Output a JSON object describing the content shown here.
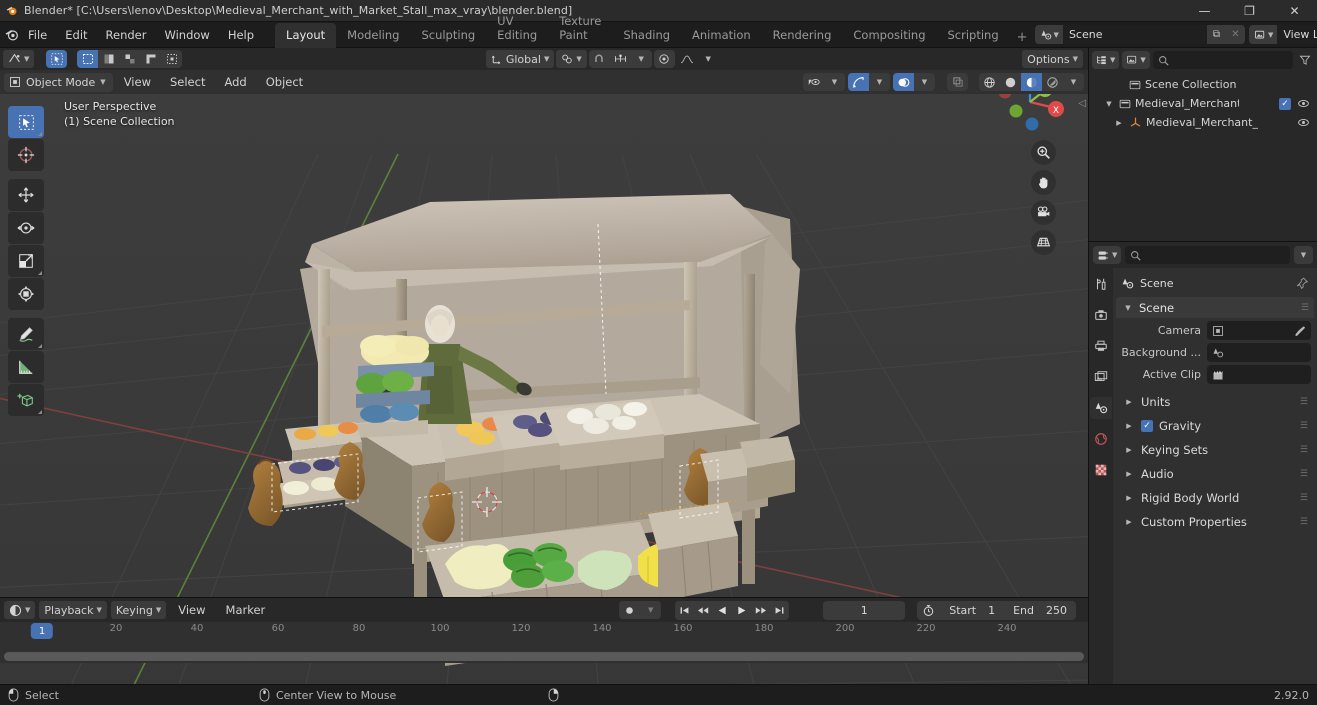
{
  "window": {
    "title": "Blender* [C:\\Users\\lenov\\Desktop\\Medieval_Merchant_with_Market_Stall_max_vray\\blender.blend]",
    "minimize": "—",
    "maximize": "❐",
    "close": "✕"
  },
  "menubar": {
    "items": [
      "File",
      "Edit",
      "Render",
      "Window",
      "Help"
    ],
    "workspaces": [
      {
        "label": "Layout",
        "active": true
      },
      {
        "label": "Modeling",
        "active": false
      },
      {
        "label": "Sculpting",
        "active": false
      },
      {
        "label": "UV Editing",
        "active": false
      },
      {
        "label": "Texture Paint",
        "active": false
      },
      {
        "label": "Shading",
        "active": false
      },
      {
        "label": "Animation",
        "active": false
      },
      {
        "label": "Rendering",
        "active": false
      },
      {
        "label": "Compositing",
        "active": false
      },
      {
        "label": "Scripting",
        "active": false
      }
    ],
    "add_workspace": "+",
    "scene_name": "Scene",
    "view_layer_name": "View Layer",
    "new_copy": "⧉",
    "unlink": "✕"
  },
  "viewport": {
    "header": {
      "editor_type": "editor-type-3dview",
      "mode": "Object Mode",
      "menus": [
        "View",
        "Select",
        "Add",
        "Object"
      ],
      "transform_orientation": "Global",
      "options_label": "Options",
      "select_modes": [
        "tweak",
        "select-box",
        "select-circle",
        "select-lasso",
        "select-extend"
      ],
      "shading_modes": [
        "wireframe",
        "solid",
        "material-preview",
        "rendered"
      ],
      "active_shading": "material-preview"
    },
    "overlay_text_line1": "User Perspective",
    "overlay_text_line2": "(1) Scene Collection",
    "toolbar": [
      {
        "name": "tweak-select-tool",
        "active": true
      },
      {
        "name": "cursor-tool",
        "active": false
      },
      {
        "name": "move-tool",
        "active": false
      },
      {
        "name": "rotate-tool",
        "active": false
      },
      {
        "name": "scale-tool",
        "active": false
      },
      {
        "name": "transform-tool",
        "active": false
      },
      {
        "name": "annotate-tool",
        "active": false
      },
      {
        "name": "measure-tool",
        "active": false
      },
      {
        "name": "add-cube-tool",
        "active": false
      }
    ],
    "gizmo_axes": {
      "x": "X",
      "y": "Y",
      "z": "Z",
      "x_color": "#e04a4a",
      "y_color": "#8bc34a",
      "z_color": "#3d8fe0"
    },
    "nav_buttons": [
      "zoom-icon",
      "pan-hand-icon",
      "camera-icon",
      "orthographic-icon"
    ],
    "scene_description": "Medieval merchant with market stall: canopy-covered wooden stall, merchant figure in green robe, crates of produce (apples, grapes, cabbages, watermelons, lemons), burlap sacks and wooden crates"
  },
  "outliner": {
    "display_mode": "view-layer",
    "filter_icon": "filter-icon",
    "search_placeholder": "",
    "rows": [
      {
        "label": "Scene Collection",
        "icon": "collection-icon",
        "indent": 0,
        "expand": "",
        "checkbox": false,
        "eye": false
      },
      {
        "label": "Medieval_Merchant_with",
        "icon": "collection-icon",
        "indent": 1,
        "expand": "▼",
        "checkbox": true,
        "eye": true
      },
      {
        "label": "Medieval_Merchant_",
        "icon": "empty-axes-icon",
        "indent": 2,
        "expand": "▶",
        "checkbox": false,
        "eye": true
      }
    ]
  },
  "properties": {
    "search_placeholder": "",
    "tabs": [
      "tool-icon",
      "render-icon",
      "output-icon",
      "view-layer-icon",
      "scene-icon",
      "world-icon",
      "texture-icon"
    ],
    "active_tab": "scene-icon",
    "breadcrumb": "Scene",
    "pin_icon": "pin-icon",
    "panel_title": "Scene",
    "fields": [
      {
        "label": "Camera",
        "icon": "camera-data-icon",
        "value": "",
        "extra": "eyedropper-icon"
      },
      {
        "label": "Background ...",
        "icon": "scene-data-icon",
        "value": "",
        "extra": ""
      },
      {
        "label": "Active Clip",
        "icon": "clip-icon",
        "value": "",
        "extra": ""
      }
    ],
    "sections": [
      {
        "label": "Units",
        "checkbox": null
      },
      {
        "label": "Gravity",
        "checkbox": true
      },
      {
        "label": "Keying Sets",
        "checkbox": null
      },
      {
        "label": "Audio",
        "checkbox": null
      },
      {
        "label": "Rigid Body World",
        "checkbox": null
      },
      {
        "label": "Custom Properties",
        "checkbox": null
      }
    ]
  },
  "timeline": {
    "editor_icon": "timeline-icon",
    "menus": [
      "Playback",
      "Keying",
      "View",
      "Marker"
    ],
    "record_icon": "record-icon",
    "transport": [
      "jump-start",
      "prev-keyframe",
      "play-reverse",
      "play",
      "next-keyframe",
      "jump-end"
    ],
    "current_frame": "1",
    "auto_key_icon": "stopwatch-icon",
    "start_label": "Start",
    "start_value": "1",
    "end_label": "End",
    "end_value": "250",
    "ruler_ticks": [
      "20",
      "40",
      "60",
      "80",
      "100",
      "120",
      "140",
      "160",
      "180",
      "200",
      "220",
      "240"
    ],
    "playhead_label": "1"
  },
  "statusbar": {
    "hints": [
      {
        "icon": "mouse-left-icon",
        "label": "Select"
      },
      {
        "icon": "mouse-middle-icon",
        "label": "Center View to Mouse"
      },
      {
        "icon": "mouse-right-icon",
        "label": ""
      }
    ],
    "version": "2.92.0"
  }
}
